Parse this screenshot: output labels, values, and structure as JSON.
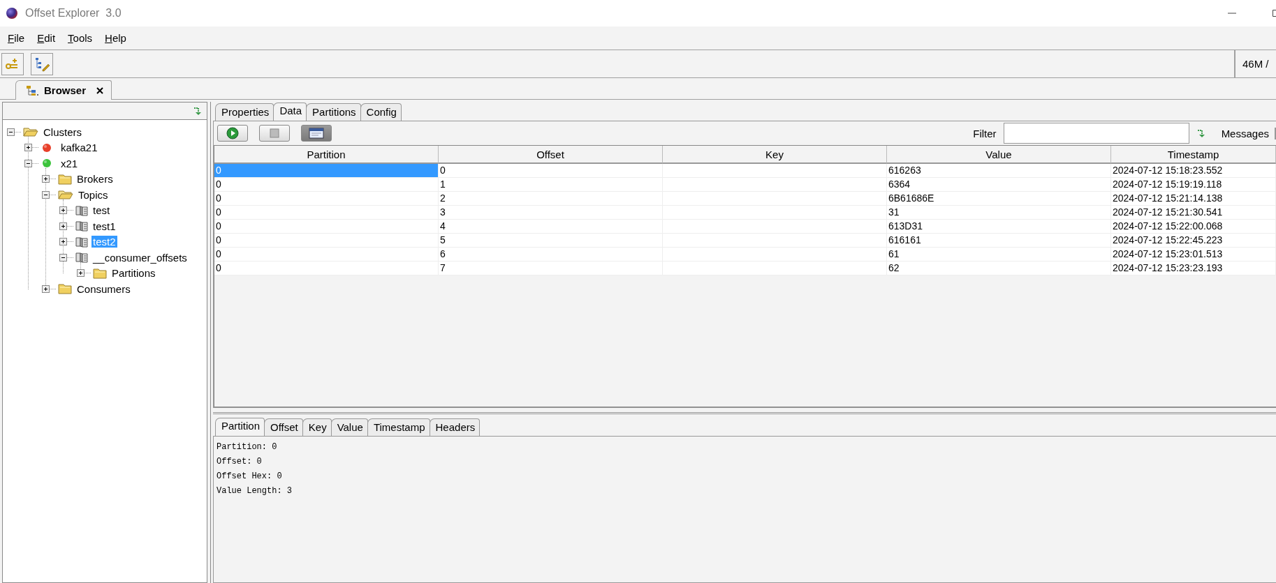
{
  "window": {
    "title": "Offset Explorer  3.0"
  },
  "menu": [
    {
      "label": "File"
    },
    {
      "label": "Edit"
    },
    {
      "label": "Tools"
    },
    {
      "label": "Help"
    }
  ],
  "memory": "46M /",
  "view_tabs": [
    {
      "label": "Browser",
      "selected": true
    }
  ],
  "tree": [
    {
      "label": "Clusters",
      "kind": "folder",
      "expanded": true,
      "selected": false,
      "children": [
        {
          "label": "kafka21",
          "kind": "cluster",
          "color": "#e8402a",
          "expanded": false,
          "selected": false
        },
        {
          "label": "x21",
          "kind": "cluster",
          "color": "#3cc43c",
          "expanded": true,
          "selected": false,
          "children": [
            {
              "label": "Brokers",
              "kind": "folder",
              "expanded": false,
              "selected": false
            },
            {
              "label": "Topics",
              "kind": "folder",
              "expanded": true,
              "selected": false,
              "children": [
                {
                  "label": "test",
                  "kind": "topic",
                  "expanded": false,
                  "selected": false
                },
                {
                  "label": "test1",
                  "kind": "topic",
                  "expanded": false,
                  "selected": false
                },
                {
                  "label": "test2",
                  "kind": "topic",
                  "expanded": false,
                  "selected": true
                },
                {
                  "label": "__consumer_offsets",
                  "kind": "topic",
                  "expanded": true,
                  "selected": false,
                  "children": [
                    {
                      "label": "Partitions",
                      "kind": "folder",
                      "expanded": false,
                      "selected": false
                    }
                  ]
                }
              ]
            },
            {
              "label": "Consumers",
              "kind": "folder",
              "expanded": false,
              "selected": false
            }
          ]
        }
      ]
    }
  ],
  "topic_tabs": [
    {
      "label": "Properties",
      "selected": false
    },
    {
      "label": "Data",
      "selected": true
    },
    {
      "label": "Partitions",
      "selected": false
    },
    {
      "label": "Config",
      "selected": false
    }
  ],
  "data_toolbar": {
    "filter_label": "Filter",
    "messages_label": "Messages"
  },
  "table": {
    "columns": [
      "Partition",
      "Offset",
      "Key",
      "Value",
      "Timestamp"
    ],
    "rows": [
      {
        "cells": [
          "0",
          "0",
          "",
          "616263",
          "2024-07-12 15:18:23.552"
        ],
        "selected": true
      },
      {
        "cells": [
          "0",
          "1",
          "",
          "6364",
          "2024-07-12 15:19:19.118"
        ],
        "selected": false
      },
      {
        "cells": [
          "0",
          "2",
          "",
          "6B61686E",
          "2024-07-12 15:21:14.138"
        ],
        "selected": false
      },
      {
        "cells": [
          "0",
          "3",
          "",
          "31",
          "2024-07-12 15:21:30.541"
        ],
        "selected": false
      },
      {
        "cells": [
          "0",
          "4",
          "",
          "613D31",
          "2024-07-12 15:22:00.068"
        ],
        "selected": false
      },
      {
        "cells": [
          "0",
          "5",
          "",
          "616161",
          "2024-07-12 15:22:45.223"
        ],
        "selected": false
      },
      {
        "cells": [
          "0",
          "6",
          "",
          "61",
          "2024-07-12 15:23:01.513"
        ],
        "selected": false
      },
      {
        "cells": [
          "0",
          "7",
          "",
          "62",
          "2024-07-12 15:23:23.193"
        ],
        "selected": false
      }
    ]
  },
  "detail_tabs": [
    {
      "label": "Partition",
      "selected": true
    },
    {
      "label": "Offset",
      "selected": false
    },
    {
      "label": "Key",
      "selected": false
    },
    {
      "label": "Value",
      "selected": false
    },
    {
      "label": "Timestamp",
      "selected": false
    },
    {
      "label": "Headers",
      "selected": false
    }
  ],
  "detail_lines": [
    "Partition: 0",
    "Offset: 0",
    "Offset Hex: 0",
    "Value Length: 3"
  ]
}
